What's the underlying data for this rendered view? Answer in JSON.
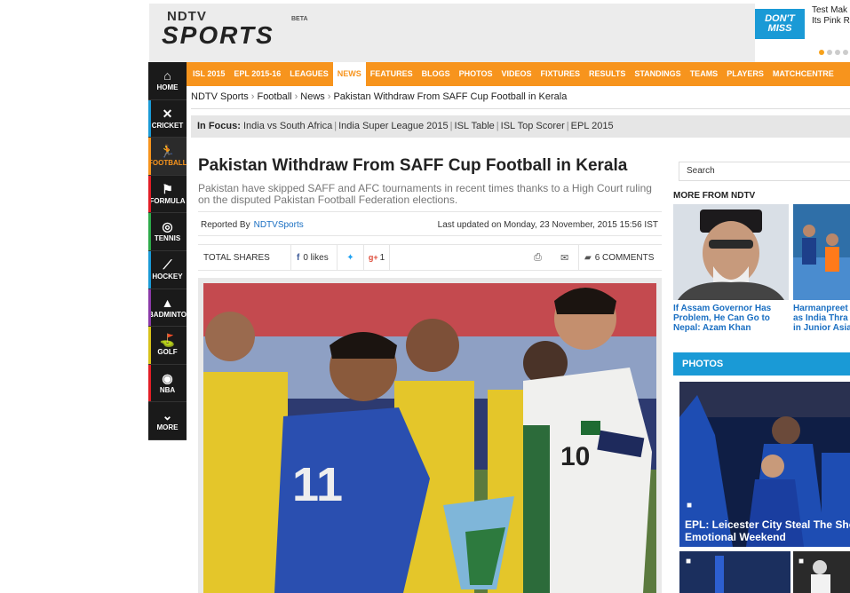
{
  "header": {
    "logo_top": "NDTV",
    "logo_main": "SPORTS",
    "logo_beta": "BETA",
    "ad_logo_line1": "DON'T",
    "ad_logo_line2": "MISS",
    "ad_text_line1": "Test Mak",
    "ad_text_line2": "Its Pink R"
  },
  "sidenav": [
    {
      "label": "HOME",
      "icon": "home-icon"
    },
    {
      "label": "CRICKET",
      "icon": "cricket-icon"
    },
    {
      "label": "FOOTBALL",
      "icon": "football-icon"
    },
    {
      "label": "FORMULA",
      "icon": "formula-flag-icon"
    },
    {
      "label": "TENNIS",
      "icon": "tennis-icon"
    },
    {
      "label": "HOCKEY",
      "icon": "hockey-icon"
    },
    {
      "label": "BADMINTO",
      "icon": "badminton-icon"
    },
    {
      "label": "GOLF",
      "icon": "golf-icon"
    },
    {
      "label": "NBA",
      "icon": "basketball-icon"
    },
    {
      "label": "MORE",
      "icon": "chevron-down-icon"
    }
  ],
  "topnav": [
    "ISL 2015",
    "EPL 2015-16",
    "LEAGUES",
    "NEWS",
    "FEATURES",
    "BLOGS",
    "PHOTOS",
    "VIDEOS",
    "FIXTURES",
    "RESULTS",
    "STANDINGS",
    "TEAMS",
    "PLAYERS",
    "MATCHCENTRE"
  ],
  "breadcrumb": [
    "NDTV Sports",
    "Football",
    "News",
    "Pakistan Withdraw From SAFF Cup Football in Kerala"
  ],
  "focus": {
    "label": "In Focus:",
    "items": [
      "India vs South Africa",
      "India Super League 2015",
      "ISL Table",
      "ISL Top Scorer",
      "EPL 2015"
    ]
  },
  "article": {
    "title": "Pakistan Withdraw From SAFF Cup Football in Kerala",
    "summary": "Pakistan have skipped SAFF and AFC tournaments in recent times thanks to a High Court ruling on the disputed Pakistan Football Federation elections.",
    "reported_by_label": "Reported By",
    "author": "NDTVSports",
    "updated": "Last updated on Monday, 23 November, 2015 15:56 IST"
  },
  "shares": {
    "total_label": "TOTAL SHARES",
    "likes": "0 likes",
    "gplus_count": "1",
    "comments": "6 COMMENTS"
  },
  "sidebar": {
    "search_placeholder": "Search",
    "more_from": "MORE FROM NDTV",
    "story1": "If Assam Governor Has Problem, He Can Go to Nepal: Azam Khan",
    "story2_l1": "Harmanpreet",
    "story2_l2": "as India Thra",
    "story2_l3": "in Junior Asia",
    "photos_label": "PHOTOS",
    "photo_caption_l1": "EPL: Leicester City Steal The Show",
    "photo_caption_l2": "Emotional Weekend"
  },
  "colors": {
    "accent": "#f7941d",
    "link": "#1a6fc2",
    "photos_bar": "#1a9ad6"
  }
}
